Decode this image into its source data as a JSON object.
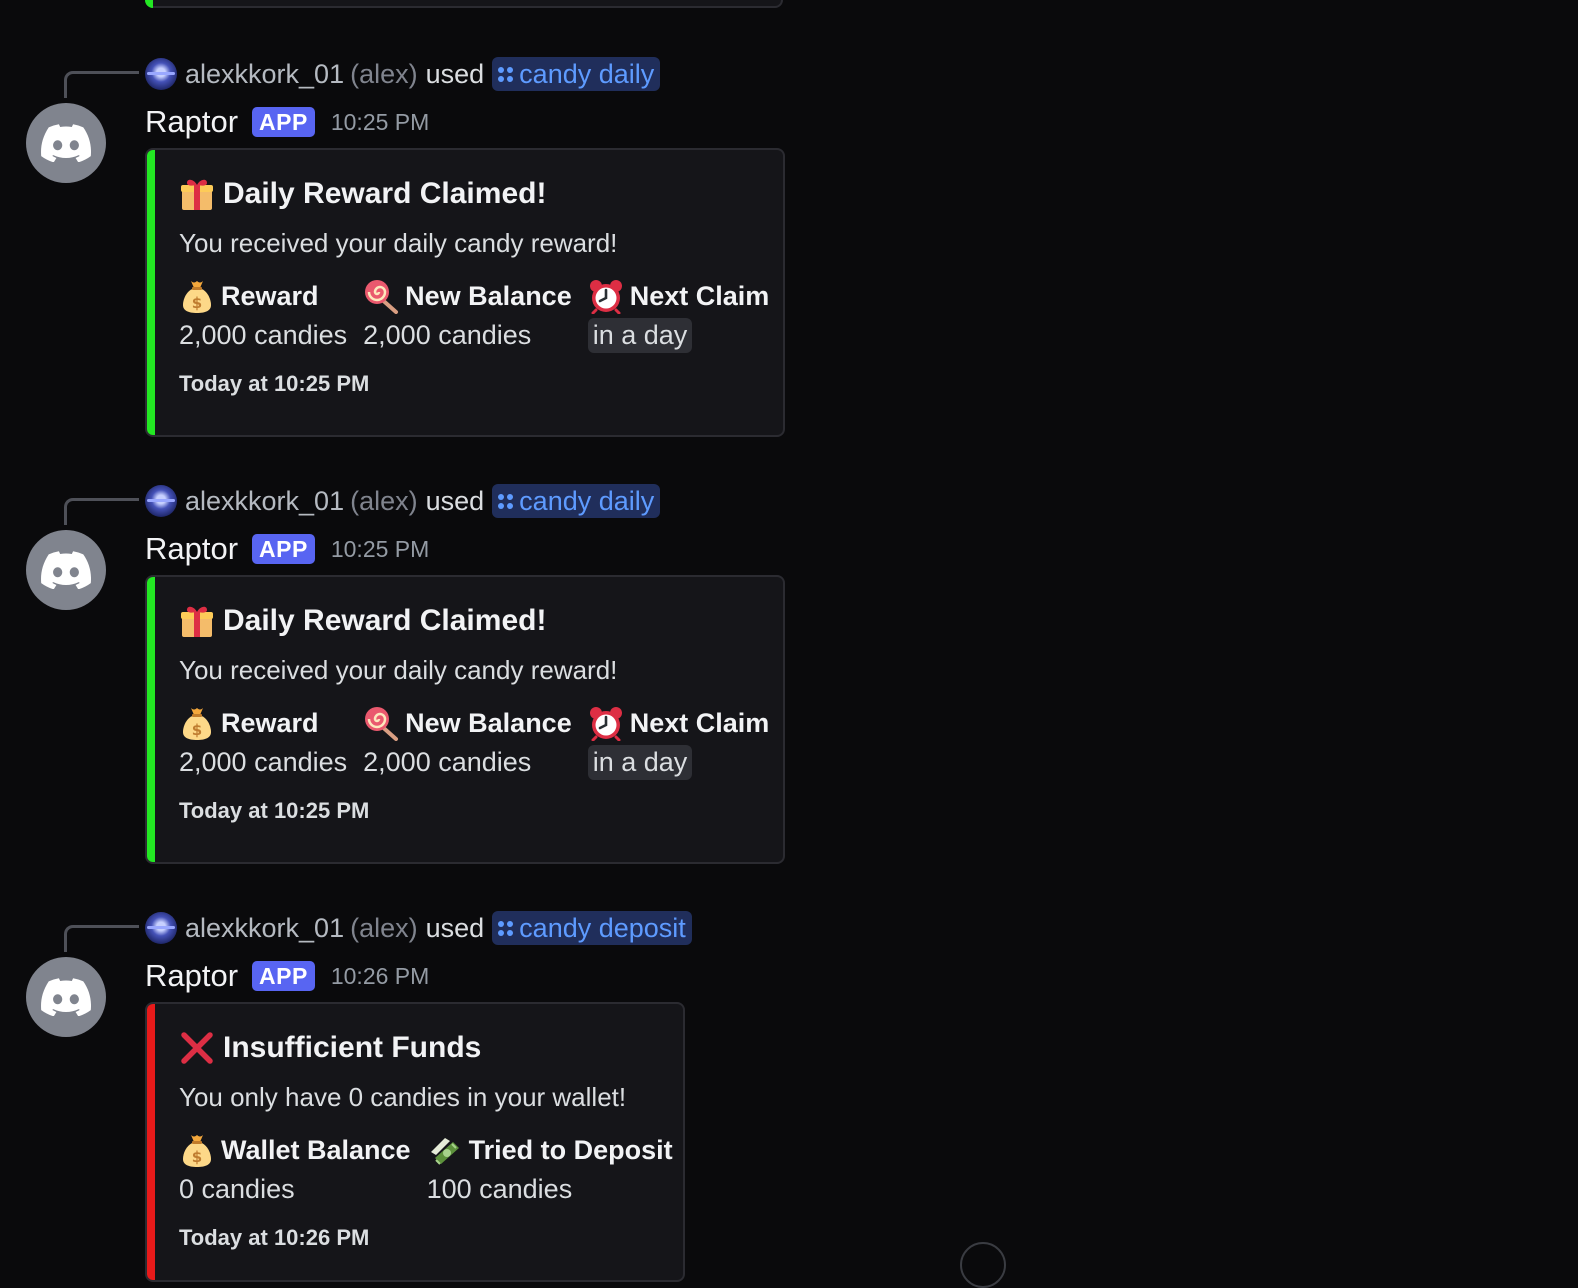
{
  "colors": {
    "success_bar": "#23e823",
    "error_bar": "#e81a1a",
    "command_text": "#5e9bff",
    "app_badge": "#5865f2"
  },
  "messages": [
    {
      "reply": {
        "user": "alexkkork_01",
        "nick": "(alex)",
        "used": "used",
        "command": "candy daily"
      },
      "author": "Raptor",
      "badge": "APP",
      "time": "10:25 PM",
      "embed": {
        "title_icon": "gift-icon",
        "title": "Daily Reward Claimed!",
        "description": "You received your daily candy reward!",
        "fields": [
          {
            "icon": "money-bag-icon",
            "name": "Reward",
            "value": "2,000 candies"
          },
          {
            "icon": "lollipop-icon",
            "name": "New Balance",
            "value": "2,000 candies"
          },
          {
            "icon": "alarm-clock-icon",
            "name": "Next Claim",
            "value": "in a day"
          }
        ],
        "footer": "Today at 10:25 PM"
      }
    },
    {
      "reply": {
        "user": "alexkkork_01",
        "nick": "(alex)",
        "used": "used",
        "command": "candy daily"
      },
      "author": "Raptor",
      "badge": "APP",
      "time": "10:25 PM",
      "embed": {
        "title_icon": "gift-icon",
        "title": "Daily Reward Claimed!",
        "description": "You received your daily candy reward!",
        "fields": [
          {
            "icon": "money-bag-icon",
            "name": "Reward",
            "value": "2,000 candies"
          },
          {
            "icon": "lollipop-icon",
            "name": "New Balance",
            "value": "2,000 candies"
          },
          {
            "icon": "alarm-clock-icon",
            "name": "Next Claim",
            "value": "in a day"
          }
        ],
        "footer": "Today at 10:25 PM"
      }
    },
    {
      "reply": {
        "user": "alexkkork_01",
        "nick": "(alex)",
        "used": "used",
        "command": "candy deposit"
      },
      "author": "Raptor",
      "badge": "APP",
      "time": "10:26 PM",
      "embed": {
        "title_icon": "cross-mark-icon",
        "title": "Insufficient Funds",
        "description": "You only have 0 candies in your wallet!",
        "fields": [
          {
            "icon": "money-bag-icon",
            "name": "Wallet Balance",
            "value": "0 candies"
          },
          {
            "icon": "money-with-wings-icon",
            "name": "Tried to Deposit",
            "value": "100 candies"
          }
        ],
        "footer": "Today at 10:26 PM"
      }
    }
  ]
}
